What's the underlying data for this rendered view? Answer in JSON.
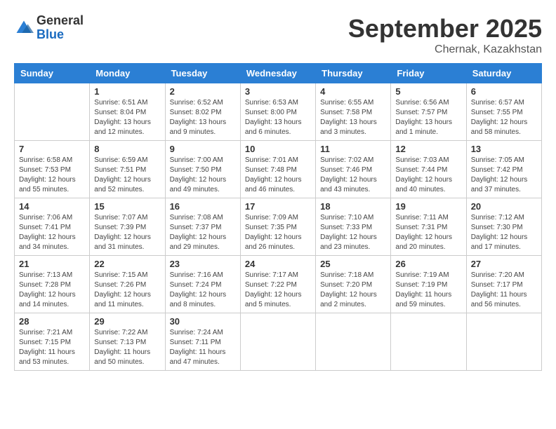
{
  "logo": {
    "general": "General",
    "blue": "Blue"
  },
  "title": "September 2025",
  "location": "Chernak, Kazakhstan",
  "days_header": [
    "Sunday",
    "Monday",
    "Tuesday",
    "Wednesday",
    "Thursday",
    "Friday",
    "Saturday"
  ],
  "weeks": [
    [
      {
        "day": "",
        "sunrise": "",
        "sunset": "",
        "daylight": ""
      },
      {
        "day": "1",
        "sunrise": "Sunrise: 6:51 AM",
        "sunset": "Sunset: 8:04 PM",
        "daylight": "Daylight: 13 hours and 12 minutes."
      },
      {
        "day": "2",
        "sunrise": "Sunrise: 6:52 AM",
        "sunset": "Sunset: 8:02 PM",
        "daylight": "Daylight: 13 hours and 9 minutes."
      },
      {
        "day": "3",
        "sunrise": "Sunrise: 6:53 AM",
        "sunset": "Sunset: 8:00 PM",
        "daylight": "Daylight: 13 hours and 6 minutes."
      },
      {
        "day": "4",
        "sunrise": "Sunrise: 6:55 AM",
        "sunset": "Sunset: 7:58 PM",
        "daylight": "Daylight: 13 hours and 3 minutes."
      },
      {
        "day": "5",
        "sunrise": "Sunrise: 6:56 AM",
        "sunset": "Sunset: 7:57 PM",
        "daylight": "Daylight: 13 hours and 1 minute."
      },
      {
        "day": "6",
        "sunrise": "Sunrise: 6:57 AM",
        "sunset": "Sunset: 7:55 PM",
        "daylight": "Daylight: 12 hours and 58 minutes."
      }
    ],
    [
      {
        "day": "7",
        "sunrise": "Sunrise: 6:58 AM",
        "sunset": "Sunset: 7:53 PM",
        "daylight": "Daylight: 12 hours and 55 minutes."
      },
      {
        "day": "8",
        "sunrise": "Sunrise: 6:59 AM",
        "sunset": "Sunset: 7:51 PM",
        "daylight": "Daylight: 12 hours and 52 minutes."
      },
      {
        "day": "9",
        "sunrise": "Sunrise: 7:00 AM",
        "sunset": "Sunset: 7:50 PM",
        "daylight": "Daylight: 12 hours and 49 minutes."
      },
      {
        "day": "10",
        "sunrise": "Sunrise: 7:01 AM",
        "sunset": "Sunset: 7:48 PM",
        "daylight": "Daylight: 12 hours and 46 minutes."
      },
      {
        "day": "11",
        "sunrise": "Sunrise: 7:02 AM",
        "sunset": "Sunset: 7:46 PM",
        "daylight": "Daylight: 12 hours and 43 minutes."
      },
      {
        "day": "12",
        "sunrise": "Sunrise: 7:03 AM",
        "sunset": "Sunset: 7:44 PM",
        "daylight": "Daylight: 12 hours and 40 minutes."
      },
      {
        "day": "13",
        "sunrise": "Sunrise: 7:05 AM",
        "sunset": "Sunset: 7:42 PM",
        "daylight": "Daylight: 12 hours and 37 minutes."
      }
    ],
    [
      {
        "day": "14",
        "sunrise": "Sunrise: 7:06 AM",
        "sunset": "Sunset: 7:41 PM",
        "daylight": "Daylight: 12 hours and 34 minutes."
      },
      {
        "day": "15",
        "sunrise": "Sunrise: 7:07 AM",
        "sunset": "Sunset: 7:39 PM",
        "daylight": "Daylight: 12 hours and 31 minutes."
      },
      {
        "day": "16",
        "sunrise": "Sunrise: 7:08 AM",
        "sunset": "Sunset: 7:37 PM",
        "daylight": "Daylight: 12 hours and 29 minutes."
      },
      {
        "day": "17",
        "sunrise": "Sunrise: 7:09 AM",
        "sunset": "Sunset: 7:35 PM",
        "daylight": "Daylight: 12 hours and 26 minutes."
      },
      {
        "day": "18",
        "sunrise": "Sunrise: 7:10 AM",
        "sunset": "Sunset: 7:33 PM",
        "daylight": "Daylight: 12 hours and 23 minutes."
      },
      {
        "day": "19",
        "sunrise": "Sunrise: 7:11 AM",
        "sunset": "Sunset: 7:31 PM",
        "daylight": "Daylight: 12 hours and 20 minutes."
      },
      {
        "day": "20",
        "sunrise": "Sunrise: 7:12 AM",
        "sunset": "Sunset: 7:30 PM",
        "daylight": "Daylight: 12 hours and 17 minutes."
      }
    ],
    [
      {
        "day": "21",
        "sunrise": "Sunrise: 7:13 AM",
        "sunset": "Sunset: 7:28 PM",
        "daylight": "Daylight: 12 hours and 14 minutes."
      },
      {
        "day": "22",
        "sunrise": "Sunrise: 7:15 AM",
        "sunset": "Sunset: 7:26 PM",
        "daylight": "Daylight: 12 hours and 11 minutes."
      },
      {
        "day": "23",
        "sunrise": "Sunrise: 7:16 AM",
        "sunset": "Sunset: 7:24 PM",
        "daylight": "Daylight: 12 hours and 8 minutes."
      },
      {
        "day": "24",
        "sunrise": "Sunrise: 7:17 AM",
        "sunset": "Sunset: 7:22 PM",
        "daylight": "Daylight: 12 hours and 5 minutes."
      },
      {
        "day": "25",
        "sunrise": "Sunrise: 7:18 AM",
        "sunset": "Sunset: 7:20 PM",
        "daylight": "Daylight: 12 hours and 2 minutes."
      },
      {
        "day": "26",
        "sunrise": "Sunrise: 7:19 AM",
        "sunset": "Sunset: 7:19 PM",
        "daylight": "Daylight: 11 hours and 59 minutes."
      },
      {
        "day": "27",
        "sunrise": "Sunrise: 7:20 AM",
        "sunset": "Sunset: 7:17 PM",
        "daylight": "Daylight: 11 hours and 56 minutes."
      }
    ],
    [
      {
        "day": "28",
        "sunrise": "Sunrise: 7:21 AM",
        "sunset": "Sunset: 7:15 PM",
        "daylight": "Daylight: 11 hours and 53 minutes."
      },
      {
        "day": "29",
        "sunrise": "Sunrise: 7:22 AM",
        "sunset": "Sunset: 7:13 PM",
        "daylight": "Daylight: 11 hours and 50 minutes."
      },
      {
        "day": "30",
        "sunrise": "Sunrise: 7:24 AM",
        "sunset": "Sunset: 7:11 PM",
        "daylight": "Daylight: 11 hours and 47 minutes."
      },
      {
        "day": "",
        "sunrise": "",
        "sunset": "",
        "daylight": ""
      },
      {
        "day": "",
        "sunrise": "",
        "sunset": "",
        "daylight": ""
      },
      {
        "day": "",
        "sunrise": "",
        "sunset": "",
        "daylight": ""
      },
      {
        "day": "",
        "sunrise": "",
        "sunset": "",
        "daylight": ""
      }
    ]
  ]
}
